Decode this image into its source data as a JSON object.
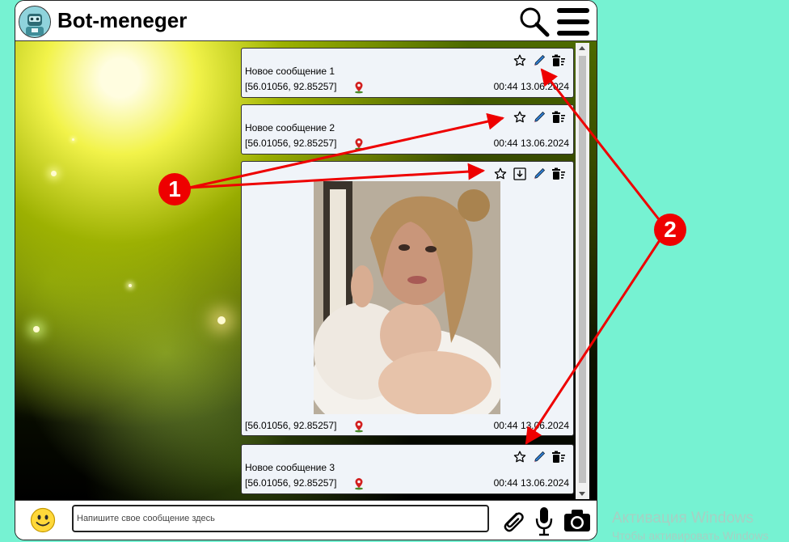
{
  "app": {
    "title": "Bot-meneger",
    "avatar_icon": "robot-avatar-icon",
    "search_icon": "search-icon",
    "menu_icon": "hamburger-menu-icon"
  },
  "messages": [
    {
      "text": "Новое сообщение 1",
      "coords": "[56.01056, 92.85257]",
      "time": "00:44 13.06.2024",
      "has_image": false,
      "actions": [
        "star-icon",
        "edit-pencil-icon",
        "delete-icon"
      ]
    },
    {
      "text": "Новое сообщение 2",
      "coords": "[56.01056, 92.85257]",
      "time": "00:44 13.06.2024",
      "has_image": false,
      "actions": [
        "star-icon",
        "edit-pencil-icon",
        "delete-icon"
      ]
    },
    {
      "text": "",
      "coords": "[56.01056, 92.85257]",
      "time": "00:44 13.06.2024",
      "has_image": true,
      "actions": [
        "star-icon",
        "download-icon",
        "edit-pencil-icon",
        "delete-icon"
      ]
    },
    {
      "text": "Новое сообщение 3",
      "coords": "[56.01056, 92.85257]",
      "time": "00:44 13.06.2024",
      "has_image": false,
      "actions": [
        "star-icon",
        "edit-pencil-icon",
        "delete-icon"
      ]
    }
  ],
  "composer": {
    "placeholder": "Напишите свое сообщение здесь",
    "emoji_icon": "smiley-emoji-icon",
    "attach_icon": "paperclip-icon",
    "mic_icon": "microphone-icon",
    "camera_icon": "camera-icon"
  },
  "annotations": {
    "badge_1": "1",
    "badge_2": "2",
    "arrow_color": "#ee0000"
  },
  "watermark": {
    "line1": "Активация Windows",
    "line2": "Чтобы активировать Windows"
  },
  "colors": {
    "page_background": "#76f2d2",
    "message_background": "#f0f4f9",
    "annotation_red": "#ee0000"
  }
}
